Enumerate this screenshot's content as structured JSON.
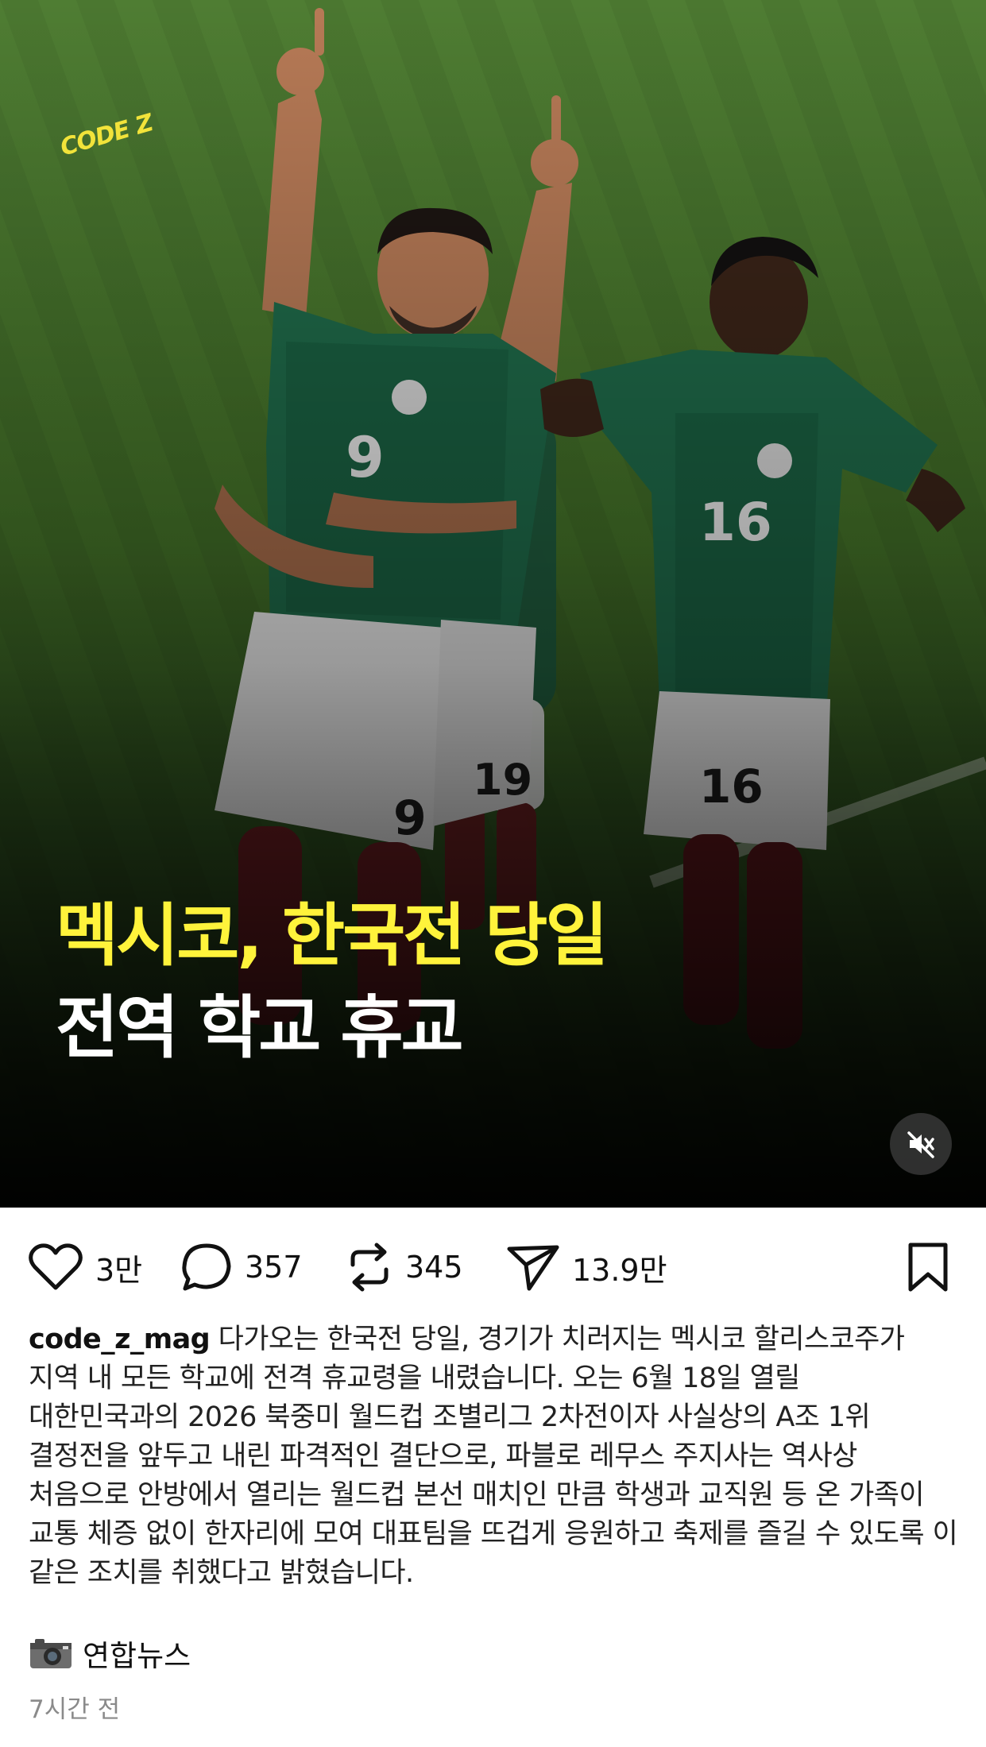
{
  "post": {
    "brand_mark": "CODE Z",
    "headline_line1": "멕시코, 한국전 당일",
    "headline_line2": "전역 학교 휴교",
    "colors": {
      "headline_highlight": "#fff33b",
      "headline_text": "#ffffff",
      "brand": "#f2e33a"
    }
  },
  "actions": {
    "like_icon": "heart-icon",
    "like_count": "3만",
    "comment_icon": "comment-bubble-icon",
    "comment_count": "357",
    "repost_icon": "repost-icon",
    "repost_count": "345",
    "share_icon": "send-icon",
    "share_count": "13.9만",
    "save_icon": "bookmark-icon",
    "mute_icon": "muted-speaker-icon"
  },
  "caption": {
    "username": "code_z_mag",
    "text": " 다가오는 한국전 당일, 경기가 치러지는 멕시코 할리스코주가 지역 내 모든 학교에 전격 휴교령을 내렸습니다. 오는 6월 18일 열릴 대한민국과의 2026 북중미 월드컵 조별리그 2차전이자 사실상의 A조 1위 결정전을 앞두고 내린 파격적인 결단으로, 파블로 레무스 주지사는 역사상 처음으로 안방에서 열리는 월드컵 본선 매치인 만큼 학생과 교직원 등 온 가족이 교통 체증 없이 한자리에 모여 대표팀을 뜨겁게 응원하고 축제를 즐길 수 있도록 이 같은 조치를 취했다고 밝혔습니다."
  },
  "source": {
    "icon": "camera-icon",
    "label": "연합뉴스"
  },
  "timestamp": "7시간 전"
}
